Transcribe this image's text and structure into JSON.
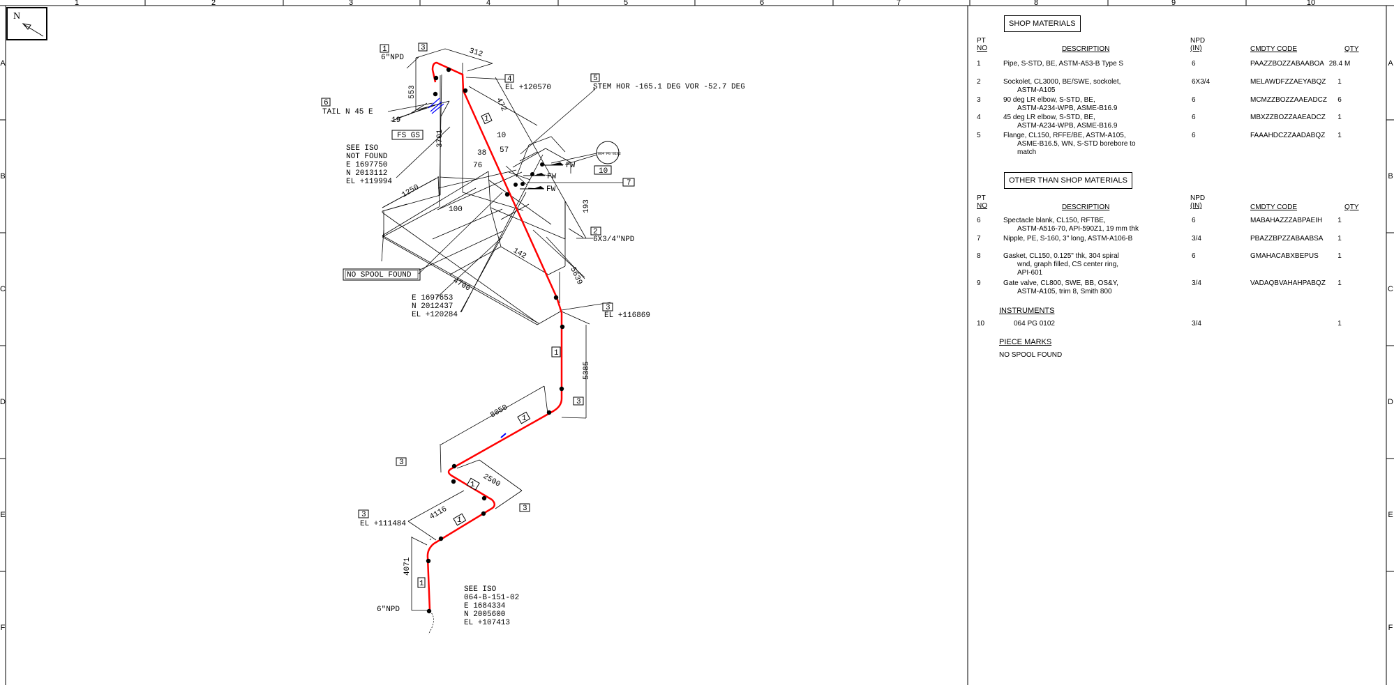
{
  "grid": {
    "columns": [
      "1",
      "2",
      "3",
      "4",
      "5",
      "6",
      "7",
      "8",
      "9",
      "10"
    ],
    "rows": [
      "A",
      "B",
      "C",
      "D",
      "E",
      "F"
    ]
  },
  "north_arrow": {
    "label": "N"
  },
  "drawing": {
    "pipe_color": "#ff0000",
    "dimensions": {
      "d312": "312",
      "d553": "553",
      "d472": "472",
      "d3701": "3701",
      "d1250": "1250",
      "d100": "100",
      "d10": "10",
      "d57": "57",
      "d38": "38",
      "d76": "76",
      "d193": "193",
      "d142": "142",
      "d5639": "5639",
      "d4700": "4700",
      "d5385": "5385",
      "d8050": "8050",
      "d2500": "2500",
      "d4116": "4116",
      "d4071": "4071",
      "d19": "19"
    },
    "labels": {
      "npd_top": "6\"NPD",
      "el_120570": "EL +120570",
      "stem": "STEM HOR -165.1 DEG  VOR -52.7 DEG",
      "tail": "TAIL N  45 E",
      "fs_gs": "FS GS",
      "see_iso_top": [
        "SEE ISO",
        "NOT FOUND",
        "E 1697750",
        "N 2013112",
        "EL +119994"
      ],
      "no_spool": "NO SPOOL FOUND",
      "coord_mid": [
        "E 1697653",
        "N 2012437",
        "EL +120284"
      ],
      "el_116869": "EL +116869",
      "npd_6x34": "6X3/4\"NPD",
      "el_111484": "EL +111484",
      "npd_bottom": "6\"NPD",
      "see_iso_bottom": [
        "SEE ISO",
        "064-B-151-02",
        "E 1684334",
        "N 2005600",
        "EL +107413"
      ],
      "fw": "FW",
      "instrument_tag": "064 PG 0102"
    },
    "callouts": {
      "c1": "1",
      "c2": "2",
      "c3": "3",
      "c4": "4",
      "c5": "5",
      "c6": "6",
      "c7": "7",
      "c10": "10"
    }
  },
  "shop_materials": {
    "title": "SHOP MATERIALS",
    "headers": {
      "pt_no": [
        "PT",
        "NO"
      ],
      "description": "DESCRIPTION",
      "npd": [
        "NPD",
        "(IN)"
      ],
      "cmdty_code": "CMDTY CODE",
      "qty": "QTY"
    },
    "items": [
      {
        "pt": "1",
        "desc": [
          "Pipe, S-STD, BE, ASTM-A53-B Type S"
        ],
        "npd": "6",
        "code": "PAAZZBOZZABAABOA",
        "qty": "28.4 M"
      },
      {
        "pt": "2",
        "desc": [
          "Sockolet, CL3000, BE/SWE, sockolet,",
          "ASTM-A105"
        ],
        "npd": "6X3/4",
        "code": "MELAWDFZZAEYABQZ",
        "qty": "1"
      },
      {
        "pt": "3",
        "desc": [
          "90 deg LR elbow, S-STD, BE,",
          "ASTM-A234-WPB, ASME-B16.9"
        ],
        "npd": "6",
        "code": "MCMZZBOZZAAEADCZ",
        "qty": "6"
      },
      {
        "pt": "4",
        "desc": [
          "45 deg LR elbow, S-STD, BE,",
          "ASTM-A234-WPB, ASME-B16.9"
        ],
        "npd": "6",
        "code": "MBXZZBOZZAAEADCZ",
        "qty": "1"
      },
      {
        "pt": "5",
        "desc": [
          "Flange, CL150, RFFE/BE, ASTM-A105,",
          "ASME-B16.5, WN, S-STD borebore to",
          "match"
        ],
        "npd": "6",
        "code": "FAAAHDCZZAADABQZ",
        "qty": "1"
      }
    ]
  },
  "other_materials": {
    "title": "OTHER THAN SHOP MATERIALS",
    "headers": {
      "pt_no": [
        "PT",
        "NO"
      ],
      "description": "DESCRIPTION",
      "npd": [
        "NPD",
        "(IN)"
      ],
      "cmdty_code": "CMDTY CODE",
      "qty": "QTY"
    },
    "items": [
      {
        "pt": "6",
        "desc": [
          "Spectacle blank, CL150, RFTBE,",
          "ASTM-A516-70, API-590Z1, 19 mm thk"
        ],
        "npd": "6",
        "code": "MABAHAZZZABPAEIH",
        "qty": "1"
      },
      {
        "pt": "7",
        "desc": [
          "Nipple, PE, S-160, 3\" long, ASTM-A106-B"
        ],
        "npd": "3/4",
        "code": "PBAZZBPZZABAABSA",
        "qty": "1"
      },
      {
        "pt": "8",
        "desc": [
          "Gasket, CL150, 0.125\" thk, 304 spiral",
          "wnd, graph filled, CS center ring,",
          "API-601"
        ],
        "npd": "6",
        "code": "GMAHACABXBEPUS",
        "qty": "1"
      },
      {
        "pt": "9",
        "desc": [
          "Gate valve, CL800, SWE, BB, OS&Y,",
          "ASTM-A105, trim 8, Smith 800"
        ],
        "npd": "3/4",
        "code": "VADAQBVAHAHPABQZ",
        "qty": "1"
      }
    ]
  },
  "instruments": {
    "title": "INSTRUMENTS",
    "items": [
      {
        "pt": "10",
        "desc": "064 PG 0102",
        "npd": "3/4",
        "qty": "1"
      }
    ]
  },
  "piece_marks": {
    "title": "PIECE MARKS",
    "value": "NO SPOOL FOUND"
  }
}
